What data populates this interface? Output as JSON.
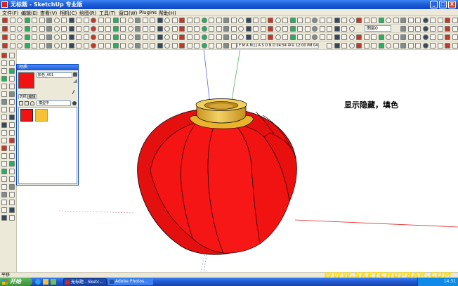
{
  "window": {
    "title": "无标题 - SketchUp 专业版",
    "controls": [
      "_",
      "□",
      "X"
    ]
  },
  "menu": [
    "文件(F)",
    "编辑(E)",
    "查看(V)",
    "相机(C)",
    "绘图(R)",
    "工具(T)",
    "窗口(W)",
    "Plugins",
    "帮助(H)"
  ],
  "toolbar": {
    "layer_select": "图层0",
    "shadow_slider_text": "J F M A M J J A S O N D  04:54 中午  12:00 PM 04:48 PM"
  },
  "materials_panel": {
    "title": "材质",
    "material_name": "颜色_A01",
    "tabs": [
      "选择",
      "编辑"
    ],
    "library": "模型中",
    "swatches": [
      {
        "name": "red",
        "color": "#f21212"
      },
      {
        "name": "yellow",
        "color": "#f5c233"
      }
    ]
  },
  "scene": {
    "annotation": "显示隐藏，填色",
    "lantern_color": "#f21212",
    "collar_color": "#e8b830"
  },
  "status": {
    "text": "平移"
  },
  "watermark": "WWW.SKETCHUPBAR.COM",
  "taskbar": {
    "start_label": "开始",
    "tasks": [
      "无标题 - Sketc...",
      "Adobe Photos..."
    ],
    "clock": "14:31"
  }
}
